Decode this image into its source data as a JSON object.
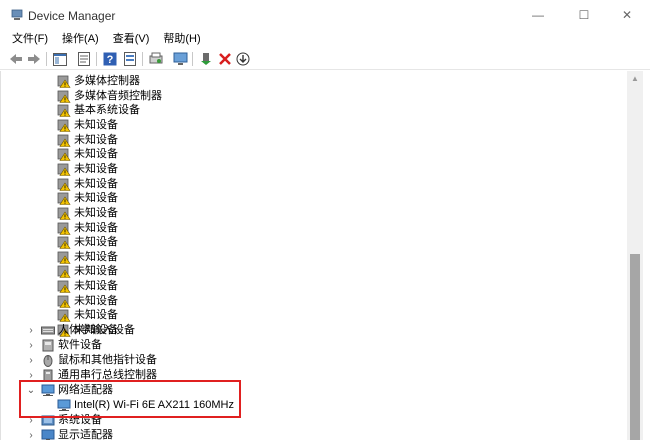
{
  "window": {
    "title": "Device Manager",
    "controls": {
      "minimize": "—",
      "maximize": "☐",
      "close": "✕"
    }
  },
  "menu": [
    "文件(F)",
    "操作(A)",
    "查看(V)",
    "帮助(H)"
  ],
  "toolbar": {
    "icons": [
      "back-arrow-icon",
      "forward-arrow-icon",
      "show-hide-console-tree-icon",
      "properties-icon",
      "help-icon",
      "update-driver-icon",
      "scan-hardware-icon",
      "monitor-icon",
      "enable-device-icon",
      "uninstall-device-icon",
      "download-icon"
    ]
  },
  "tree": {
    "other_devices_children": [
      "多媒体控制器",
      "多媒体音频控制器",
      "基本系统设备",
      "未知设备",
      "未知设备",
      "未知设备",
      "未知设备",
      "未知设备",
      "未知设备",
      "未知设备",
      "未知设备",
      "未知设备",
      "未知设备",
      "未知设备",
      "未知设备",
      "未知设备",
      "未知设备",
      "未知设备"
    ],
    "categories": {
      "hid": "人体学输入设备",
      "software": "软件设备",
      "mice": "鼠标和其他指针设备",
      "usb": "通用串行总线控制器",
      "network": "网络适配器",
      "system": "系统设备",
      "display": "显示适配器"
    },
    "network_child": "Intel(R) Wi-Fi 6E AX211 160MHz"
  },
  "colors": {
    "highlight_border": "#e02020",
    "warning_yellow": "#f2c200"
  }
}
